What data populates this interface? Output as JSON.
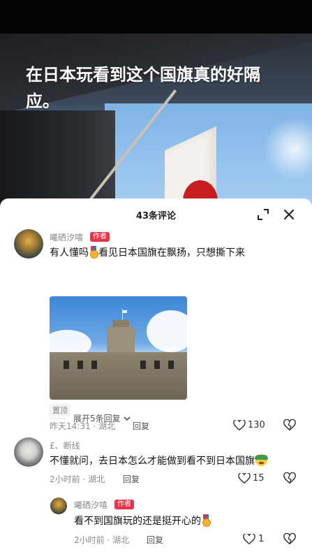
{
  "video": {
    "headline": "在日本玩看到这个国旗真的好隔应。"
  },
  "panel": {
    "title": "43条评论",
    "expand_icon": "expand-icon",
    "close_icon": "close-icon"
  },
  "comments": [
    {
      "username": "曦硒汐嘻",
      "badge": "作者",
      "text_before": "有人懂吗",
      "text_after": "看见日本国旗在飘扬，只想撕下来",
      "pin_tag": "置顶",
      "time": "昨天14:31 · 湖北",
      "reply_label": "回复",
      "likes": "130"
    },
    {
      "username": "£、断线",
      "text": "不懂就问，去日本怎么才能做到看不到日本国旗",
      "time": "2小时前 · 湖北",
      "reply_label": "回复",
      "likes": "15"
    },
    {
      "username": "曦硒汐嘻",
      "badge": "作者",
      "text": "看不到国旗玩的还是挺开心的",
      "time": "2小时前 · 湖北",
      "reply_label": "回复",
      "likes": "1"
    }
  ],
  "expand_replies": {
    "label": "展开5条回复"
  },
  "colors": {
    "badge": "#e8344a",
    "meta": "#8a8a8a"
  }
}
